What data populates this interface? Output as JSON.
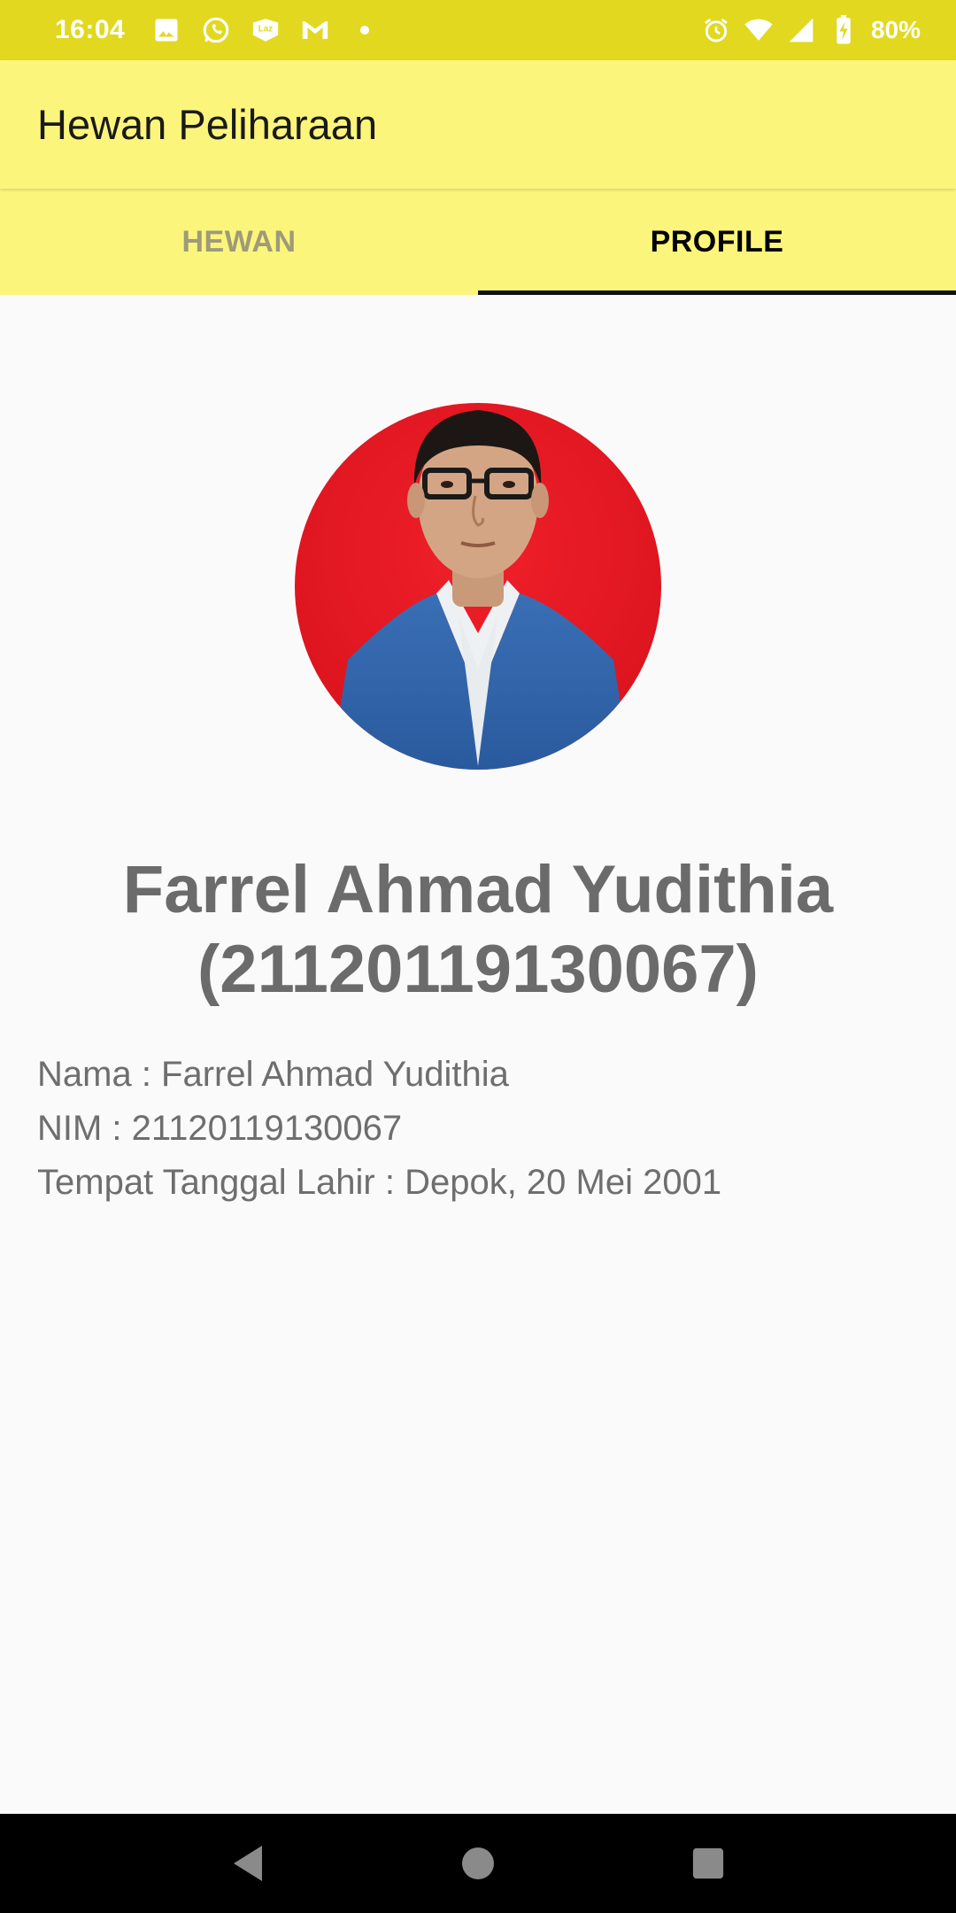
{
  "status_bar": {
    "time": "16:04",
    "battery": "80%",
    "background": "#e2d81f",
    "left_icons": [
      "gallery-icon",
      "whatsapp-icon",
      "lazada-icon",
      "gmail-icon",
      "dot-icon"
    ],
    "right_icons": [
      "alarm-icon",
      "wifi-icon",
      "cell-signal-icon",
      "battery-charging-icon"
    ]
  },
  "app_bar": {
    "title": "Hewan Peliharaan",
    "background": "#fcf57c"
  },
  "tabs": [
    {
      "label": "HEWAN",
      "active": false
    },
    {
      "label": "PROFILE",
      "active": true
    }
  ],
  "profile": {
    "display_name_line1": "Farrel Ahmad Yudithia",
    "display_name_line2": "(21120119130067)",
    "info": [
      "Nama : Farrel Ahmad Yudithia",
      "NIM : 21120119130067",
      "Tempat Tanggal Lahir : Depok, 20 Mei 2001"
    ]
  },
  "nav_bar": {
    "icons": [
      "back-icon",
      "home-icon",
      "recents-icon"
    ]
  }
}
